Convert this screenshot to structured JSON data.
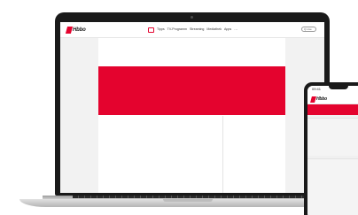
{
  "laptop": {
    "site": {
      "logo_text": "Hbbo",
      "nav": {
        "items": [
          "Tipps",
          "TV-Programm",
          "Streaming",
          "Mediathek",
          "Apps",
          "···"
        ]
      },
      "search": {
        "label": "Q Live"
      },
      "colors": {
        "brand": "#e4032e",
        "header_bg": "#ffffff",
        "page_bg": "#ffffff",
        "outer_bg": "#f2f2f2"
      }
    }
  },
  "phone": {
    "status": {
      "time": "09:41"
    },
    "logo_text": "Hbbo"
  },
  "icons": {
    "nav_tv": "tv-icon",
    "search": "search-icon",
    "camera": "camera-icon"
  }
}
